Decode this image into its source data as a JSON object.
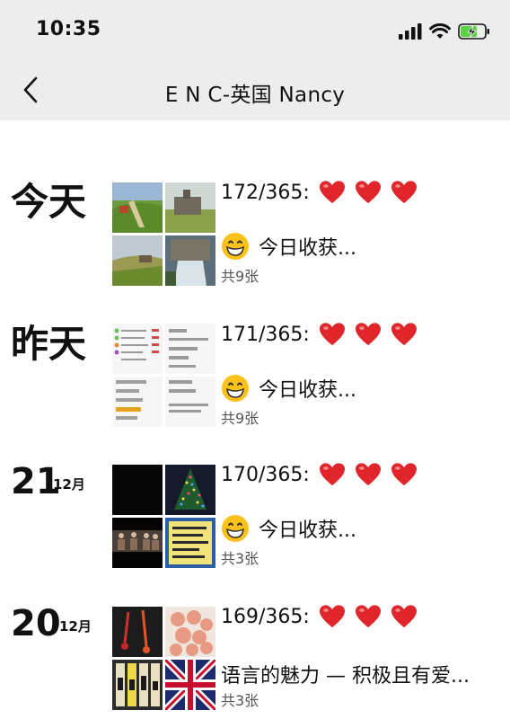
{
  "status": {
    "time": "10:35"
  },
  "nav": {
    "title": "E N C-英国 Nancy"
  },
  "entries": [
    {
      "date": "今天",
      "title": "172/365:",
      "desc": "今日收获...",
      "count": "共9张"
    },
    {
      "date": "昨天",
      "title": "171/365:",
      "desc": "今日收获...",
      "count": "共9张"
    },
    {
      "day": "21",
      "month": "12月",
      "title": "170/365:",
      "desc": "今日收获...",
      "count": "共3张"
    },
    {
      "day": "20",
      "month": "12月",
      "title": "169/365:",
      "desc": "语言的魅力 — 积极且有爱...",
      "count": "共3张"
    }
  ],
  "icons": {
    "back": "chevron-left-icon",
    "heart": "red-heart-icon",
    "smile": "grinning-face-icon",
    "signal": "cellular-signal-icon",
    "wifi": "wifi-icon",
    "battery": "battery-charging-icon"
  },
  "colors": {
    "bar_bg": "#ededed",
    "heart": "#e0262b",
    "battery": "#5ad142"
  }
}
